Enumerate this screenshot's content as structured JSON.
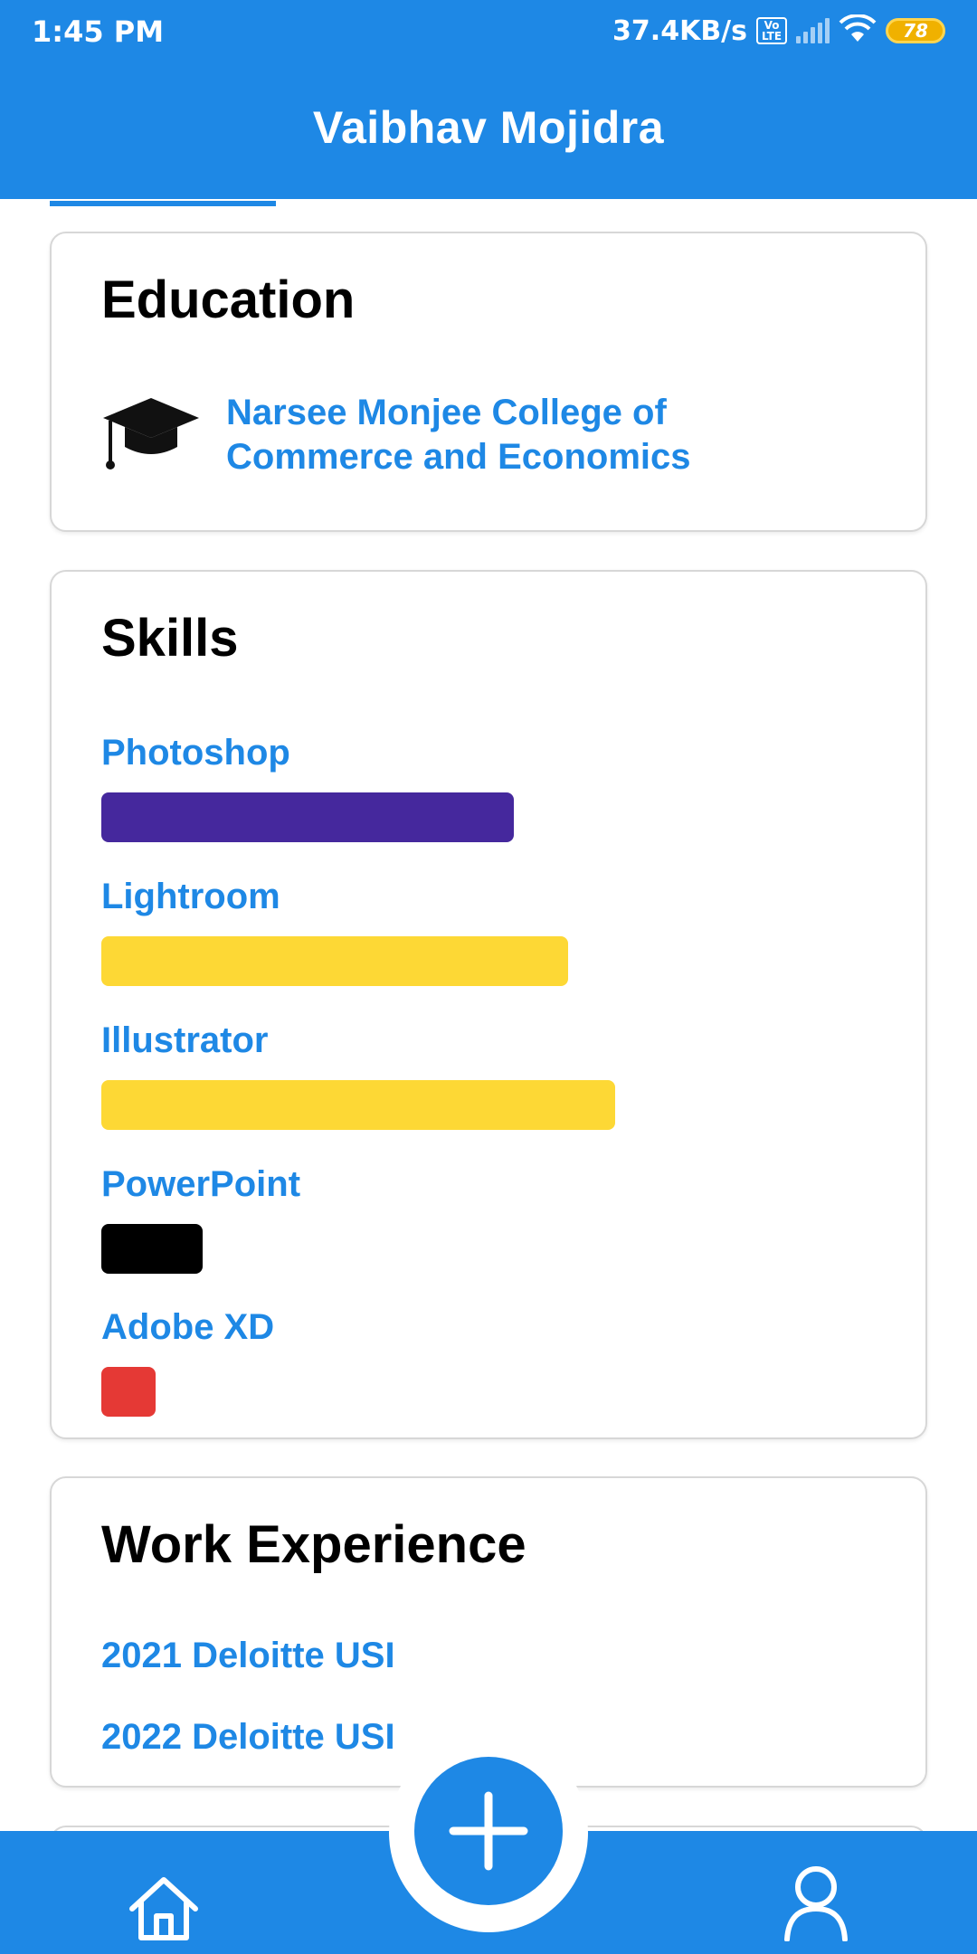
{
  "status_bar": {
    "time": "1:45 PM",
    "network_speed": "37.4KB/s",
    "volte_top": "Vo",
    "volte_bottom": "LTE",
    "battery": "78"
  },
  "app_bar": {
    "title": "Vaibhav Mojidra"
  },
  "education": {
    "title": "Education",
    "institution": "Narsee Monjee College of Commerce and Economics",
    "icon": "graduation-cap-icon"
  },
  "skills": {
    "title": "Skills",
    "items": [
      {
        "label": "Photoshop",
        "level": 0.53,
        "color": "#45289d"
      },
      {
        "label": "Lightroom",
        "level": 0.6,
        "color": "#fdd835"
      },
      {
        "label": "Illustrator",
        "level": 0.66,
        "color": "#fdd835"
      },
      {
        "label": "PowerPoint",
        "level": 0.13,
        "color": "#000000"
      },
      {
        "label": "Adobe XD",
        "level": 0.07,
        "color": "#e53935"
      }
    ]
  },
  "work_experience": {
    "title": "Work Experience",
    "items": [
      "2021 Deloitte USI",
      "2022 Deloitte USI"
    ]
  },
  "bottom_nav": {
    "home_icon": "home-icon",
    "add_icon": "plus-icon",
    "profile_icon": "user-icon"
  },
  "theme": {
    "primary": "#1e88e5"
  }
}
